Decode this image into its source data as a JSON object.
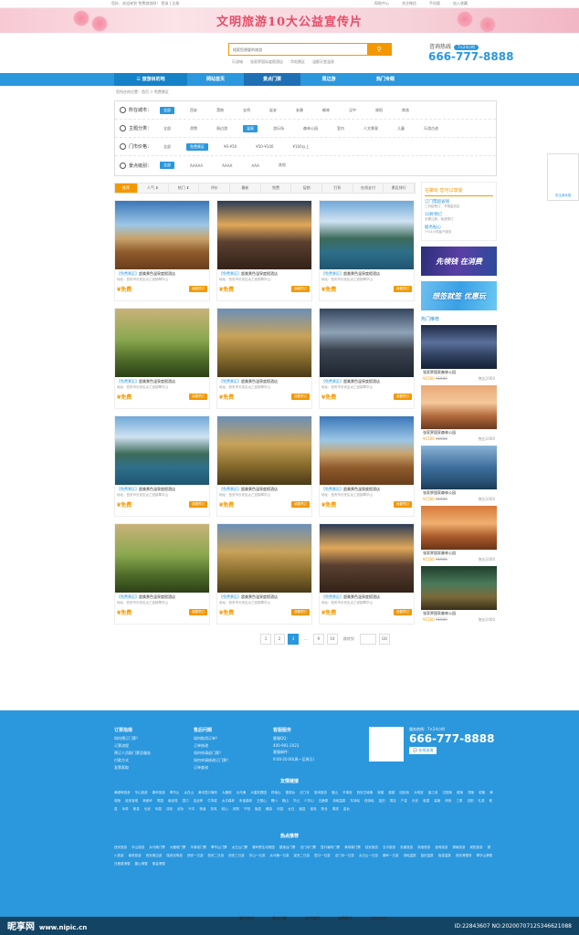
{
  "topbar": {
    "left": "您好，欢迎来到 免费旅游网！ 登录 | 注册",
    "links": [
      "帮助中心",
      "关注微信",
      "手机版",
      "加入收藏"
    ]
  },
  "banner": {
    "title": "文明旅游10大公益宣传片"
  },
  "search": {
    "placeholder": "搜索您想要的旅游",
    "hotwords": [
      "乐游城",
      "张家界国际度假酒店",
      "华阳景区",
      "温都天堂温泉"
    ]
  },
  "hotline": {
    "label": "咨询热线",
    "badge": "7×24小时",
    "phone": "666-777-8888"
  },
  "nav": {
    "home": "旅游目的地",
    "items": [
      "网站首页",
      "景点门票",
      "周边游",
      "热门专题"
    ]
  },
  "breadcrumb": "您所在的位置：首页 > 免费景区",
  "filters": [
    {
      "label": "所在城市：",
      "options": [
        "全部",
        "西安",
        "渭南",
        "宝鸡",
        "延安",
        "安康",
        "榆林",
        "汉中",
        "咸阳",
        "商洛"
      ],
      "selected": 0
    },
    {
      "label": "主题分类：",
      "options": [
        "全部",
        "滑雪",
        "周边游",
        "温泉",
        "游乐场",
        "森林公园",
        "室内",
        "人文景观",
        "儿童",
        "乐游古迹"
      ],
      "selected": 3
    },
    {
      "label": "门市价格：",
      "options": [
        "全部",
        "免费景区",
        "¥0-¥50",
        "¥50-¥100",
        "¥100以上"
      ],
      "selected": 1
    },
    {
      "label": "景点级别：",
      "options": [
        "全部",
        "AAAAA",
        "AAAA",
        "AAA",
        "其他"
      ],
      "selected": 0
    }
  ],
  "sort": [
    "推荐",
    "人气 ⬍",
    "热门 ⬍",
    "评价",
    "最新",
    "免费",
    "促销",
    "打折",
    "在线支付",
    "景区排行"
  ],
  "cards": {
    "name_tag": "【免费景区】",
    "name": "超美景色温泉度假酒店",
    "addr": "地址：西安市长安区太乙宫镇翠华山",
    "price": "免费",
    "book": "我要预订"
  },
  "pager": {
    "pages": [
      "1",
      "2",
      "3",
      "···",
      "9",
      "10"
    ],
    "current": "3",
    "jump": "跳转到",
    "go": "GO"
  },
  "side": {
    "title": "在聚玩 您可以享受",
    "features": [
      {
        "a": "订门票超省钱",
        "b": "三折起预订，不限量供应"
      },
      {
        "a": "10秒预订",
        "b": "无需注册，免费预订"
      },
      {
        "a": "服务贴心",
        "b": "7*24小时客户服务"
      }
    ],
    "ad1": "先领钱 在消费",
    "ad2": "想签就签 优惠玩",
    "rec_title": "热门推荐",
    "recs": [
      {
        "name": "张家界国家森林公园",
        "price": "¥1500",
        "old": "¥1500",
        "sold": "售出1000"
      },
      {
        "name": "张家界国家森林公园",
        "price": "¥1500",
        "old": "¥1500",
        "sold": "售出1000"
      },
      {
        "name": "张家界国家森林公园",
        "price": "¥1500",
        "old": "¥1500",
        "sold": "售出1000"
      },
      {
        "name": "张家界国家森林公园",
        "price": "¥1500",
        "old": "¥1500",
        "sold": "售出1000"
      },
      {
        "name": "张家界国家森林公园",
        "price": "¥1500",
        "old": "¥1500",
        "sold": "售出1000"
      }
    ]
  },
  "float": {
    "text": "关注参玩旅"
  },
  "footer": {
    "cols": [
      {
        "h": "订票指南",
        "items": [
          "如何预订门票？",
          "订票流程",
          "预订人员取门票及服务",
          "付款方式",
          "发票索取"
        ]
      },
      {
        "h": "售后问题",
        "items": [
          "如何取消订单？",
          "订单修改",
          "如何申请退门票？",
          "如何申请修改订门票？",
          "订单查询"
        ]
      },
      {
        "h": "客服服务",
        "items": [
          "客服QQ：",
          "400-991-2023",
          "客服邮件：",
          "9:00-20:00(周一至周日)"
        ]
      }
    ],
    "phone_label": "服务热线：7×24小时",
    "phone": "666-777-8888",
    "online": "在线咨询",
    "links_title": "友情链接",
    "hot_title": "热点推荐",
    "links": "黄峰峡旅游 华山旅游 秦岭旅游 翠华山 太白山 黄河壶口瀑布 大雁塔 兵马俑 大唐芙蓉园 终南山 楼观台 法门寺 宝鸡旅游 骊山 华清宫 西安古城墙 钟楼 鼓楼 回民街 大明宫 曲江池 汉阳陵 乾陵 茂陵 昭陵 黄帝陵 延安宝塔 杨家岭 枣园 南泥湾 壶口 金丝峡 牛背梁 太平森林 朱雀森林 王顺山 辋川 骊山 华山 少华山 白鹿原 汤峪温泉 东汤峪 西汤峪 蓝田 周至 户县 长安 临潼 高陵 阎良 三原 泾阳 礼泉 乾县 永寿 彬县 长武 旬邑 淳化 武功 兴平 杨凌 扶风 岐山 凤翔 千阳 陇县 麟游 凤县 太白 眉县 宝鸡 陈仓 渭滨 金台",
    "hot": "西安旅游 华山旅游 兵马俑门票 大雁塔门票 华清池门票 翠华山门票 太白山门票 秦岭野生动物园 楼观台门票 法门寺门票 壶口瀑布门票 黄帝陵门票 延安旅游 汉中旅游 安康旅游 商洛旅游 宝鸡旅游 渭南旅游 咸阳旅游 铜川旅游 榆林旅游 西安周边游 陕西自驾游 西安一日游 西安二日游 西安三日游 华山一日游 兵马俑一日游 延安二日游 壶口一日游 法门寺一日游 太白山一日游 秦岭一日游 汤峪温泉 蓝田温泉 临潼温泉 西安滑雪场 翠华山滑雪 白鹿原滑雪 鳌山滑雪 照金滑雪",
    "bnav": [
      "聚玩首页",
      "景点门票",
      "关于我们",
      "诚聘英才",
      "商务合作"
    ]
  },
  "watermark": {
    "logo": "昵享网",
    "site": "www.nipic.cn",
    "id": "ID:22843607 NO:20200707125346621088"
  }
}
